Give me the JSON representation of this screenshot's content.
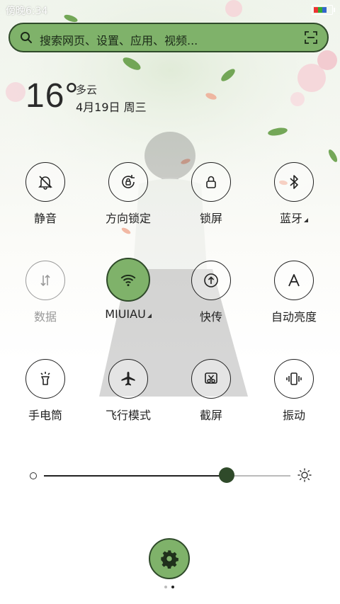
{
  "status_bar": {
    "time": "傍晚6:34"
  },
  "search": {
    "placeholder": "搜索网页、设置、应用、视频..."
  },
  "weather": {
    "temperature": "16°",
    "condition": "多云",
    "date": "4月19日 周三"
  },
  "toggles": [
    {
      "label": "静音",
      "icon": "bell-off-icon",
      "active": false,
      "dim": false
    },
    {
      "label": "方向锁定",
      "icon": "rotation-lock-icon",
      "active": false,
      "dim": false
    },
    {
      "label": "锁屏",
      "icon": "lock-icon",
      "active": false,
      "dim": false
    },
    {
      "label": "蓝牙",
      "icon": "bluetooth-icon",
      "active": false,
      "dim": false,
      "has_menu": true
    },
    {
      "label": "数据",
      "icon": "data-arrows-icon",
      "active": false,
      "dim": true
    },
    {
      "label": "MIUIAU",
      "icon": "wifi-icon",
      "active": true,
      "dim": false,
      "has_menu": true
    },
    {
      "label": "快传",
      "icon": "upload-icon",
      "active": false,
      "dim": false
    },
    {
      "label": "自动亮度",
      "icon": "auto-brightness-icon",
      "active": false,
      "dim": false
    },
    {
      "label": "手电筒",
      "icon": "flashlight-icon",
      "active": false,
      "dim": false
    },
    {
      "label": "飞行模式",
      "icon": "airplane-icon",
      "active": false,
      "dim": false
    },
    {
      "label": "截屏",
      "icon": "screenshot-icon",
      "active": false,
      "dim": false
    },
    {
      "label": "振动",
      "icon": "vibrate-icon",
      "active": false,
      "dim": false
    }
  ],
  "brightness": {
    "level": 0.74
  },
  "pager": {
    "current": 2,
    "total": 2
  },
  "colors": {
    "accent": "#7fb26a",
    "accent_dark": "#2f4a2a"
  }
}
